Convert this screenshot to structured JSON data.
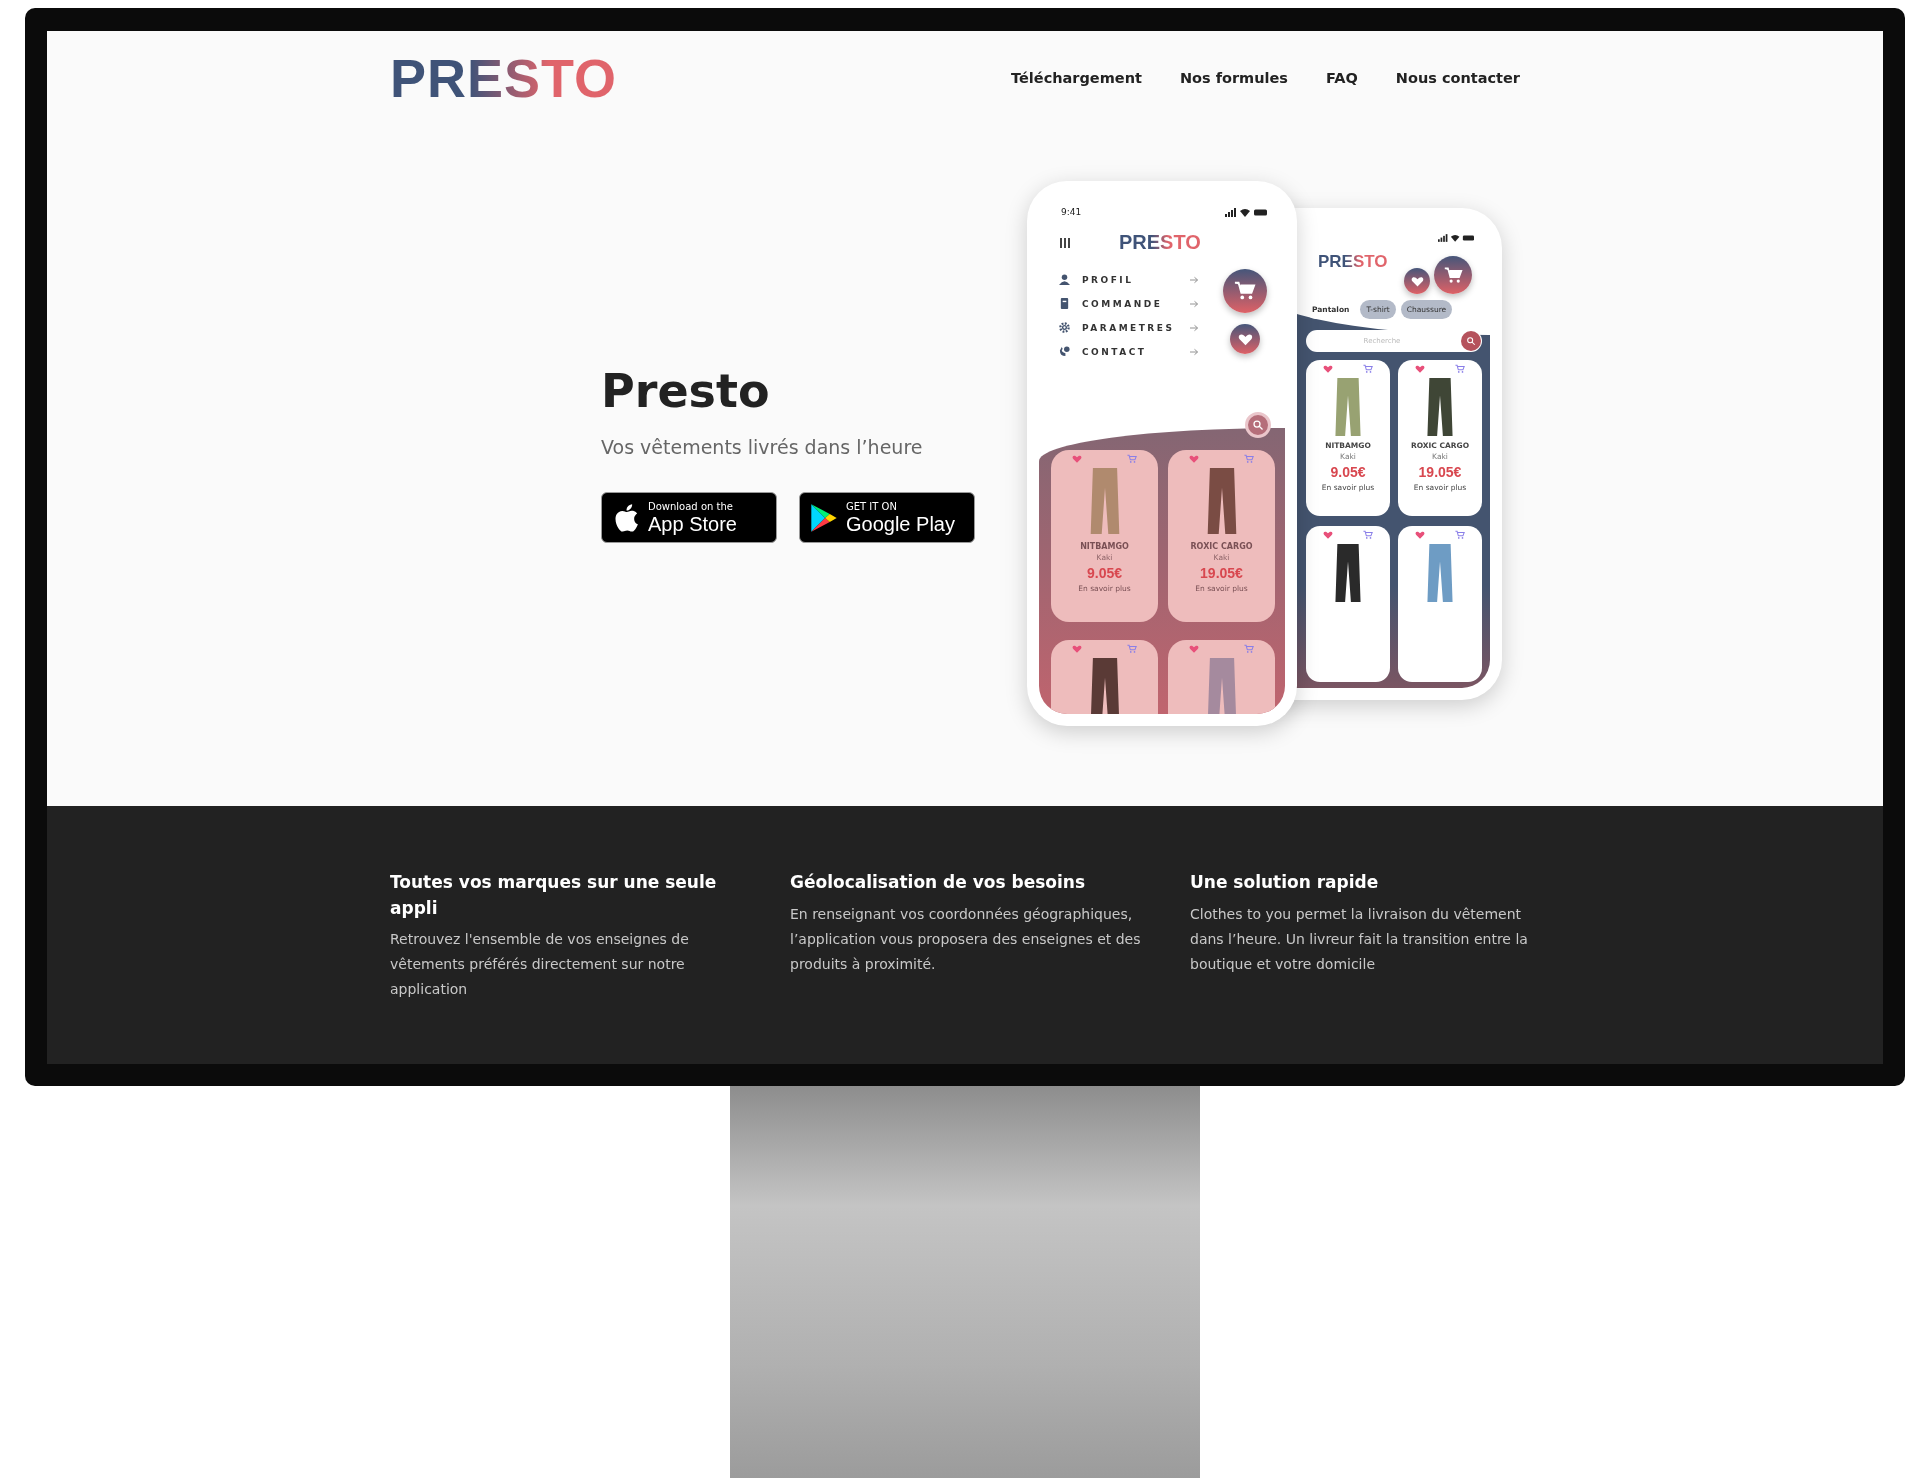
{
  "nav": {
    "logo": "PRESTO",
    "links": [
      "Téléchargement",
      "Nos formules",
      "FAQ",
      "Nous contacter"
    ]
  },
  "hero": {
    "title": "Presto",
    "subtitle": "Vos vêtements livrés dans l’heure",
    "store_buttons": [
      {
        "kind": "apple",
        "small": "Download on the",
        "big": "App Store"
      },
      {
        "kind": "google",
        "small": "GET IT ON",
        "big": "Google Play"
      }
    ]
  },
  "phones": [
    {
      "kind": "menu",
      "time": "9:41",
      "logo": "PRESTO",
      "menu": [
        "PROFIL",
        "COMMANDE",
        "PARAMETRES",
        "CONTACT"
      ],
      "products": [
        {
          "name": "NITBAMGO",
          "variant": "Kaki",
          "price": "9.05€",
          "link": "En savoir plus",
          "color": "#b08a6e"
        },
        {
          "name": "ROXIC CARGO",
          "variant": "Kaki",
          "price": "19.05€",
          "link": "En savoir plus",
          "color": "#7a4c44"
        },
        {
          "color": "#5a3a36"
        },
        {
          "color": "#a58a9e"
        }
      ]
    },
    {
      "kind": "shop",
      "logo": "PRESTO",
      "chips": [
        {
          "label": "Pantalon",
          "selected": true
        },
        {
          "label": "T-shirt",
          "selected": false
        },
        {
          "label": "Chaussure",
          "selected": false
        }
      ],
      "search_placeholder": "Recherche",
      "products": [
        {
          "name": "NITBAMGO",
          "variant": "Kaki",
          "price": "9.05€",
          "link": "En savoir plus",
          "color": "#98a272"
        },
        {
          "name": "ROXIC CARGO",
          "variant": "Kaki",
          "price": "19.05€",
          "link": "En savoir plus",
          "color": "#3f4636"
        },
        {
          "color": "#2a2a2a"
        },
        {
          "color": "#6e9cc4"
        }
      ]
    }
  ],
  "features": [
    {
      "title": "Toutes vos marques sur une seule appli",
      "text": "Retrouvez l'ensemble de vos enseignes de vêtements préférés directement sur notre application"
    },
    {
      "title": "Géolocalisation de vos besoins",
      "text": "En renseignant vos coordonnées géographiques, l’application vous proposera des enseignes et des produits à proximité."
    },
    {
      "title": "Une solution rapide",
      "text": "Clothes to you permet la livraison du vêtement dans l’heure. Un livreur fait la transition entre la boutique et votre domicile"
    }
  ]
}
